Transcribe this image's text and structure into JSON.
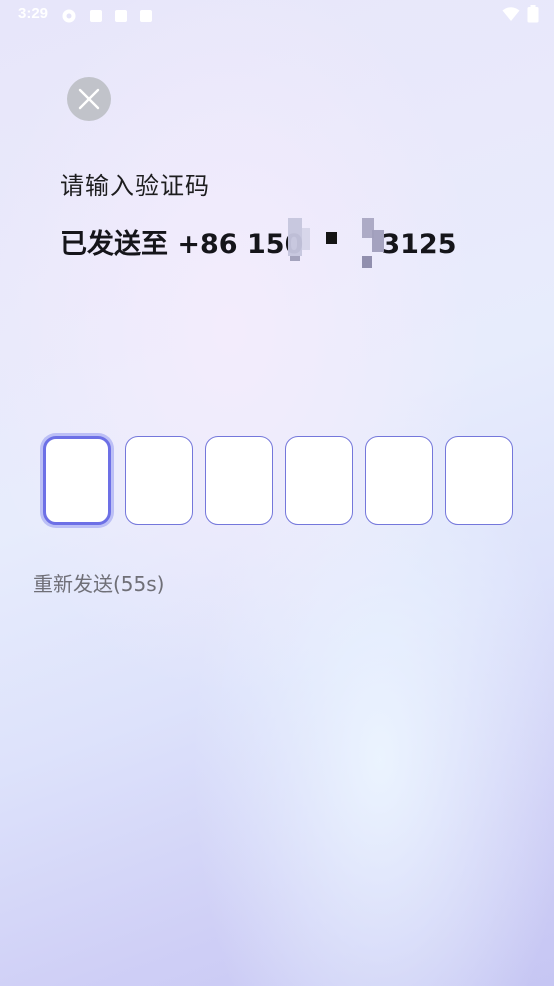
{
  "status_bar": {
    "time": "3:29"
  },
  "header": {
    "close_icon": "close-icon"
  },
  "content": {
    "subtitle": "请输入验证码",
    "sent_to_prefix": "已发送至 +86 150",
    "phone_suffix": "3125"
  },
  "code_input": {
    "length": 6,
    "values": [
      "",
      "",
      "",
      "",
      "",
      ""
    ],
    "active_index": 0
  },
  "resend": {
    "label": "重新发送(55s)"
  },
  "colors": {
    "accent": "#6d70e6",
    "box_border": "#7477db",
    "close_bg": "#c1c3ca"
  }
}
